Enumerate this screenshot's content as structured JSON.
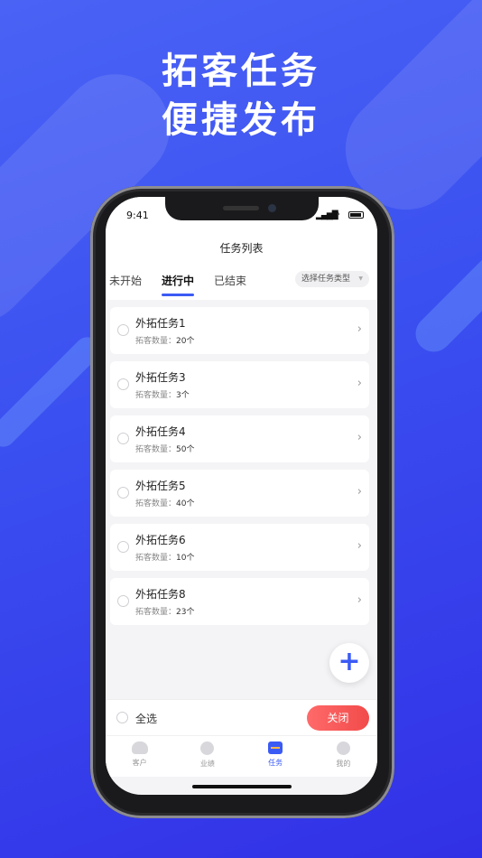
{
  "promo": {
    "line1": "拓客任务",
    "line2": "便捷发布"
  },
  "status_bar": {
    "time": "9:41",
    "signal_icon": "signal-icon",
    "wifi_icon": "wifi-icon",
    "battery_icon": "battery-icon"
  },
  "header": {
    "title": "任务列表"
  },
  "tabs": [
    {
      "label": "未开始",
      "active": false
    },
    {
      "label": "进行中",
      "active": true
    },
    {
      "label": "已结束",
      "active": false
    }
  ],
  "filter": {
    "label": "选择任务类型",
    "icon": "caret-down-icon"
  },
  "tasks": [
    {
      "name": "外拓任务1",
      "count_label": "拓客数量：",
      "count": "20个"
    },
    {
      "name": "外拓任务3",
      "count_label": "拓客数量：",
      "count": "3个"
    },
    {
      "name": "外拓任务4",
      "count_label": "拓客数量：",
      "count": "50个"
    },
    {
      "name": "外拓任务5",
      "count_label": "拓客数量：",
      "count": "40个"
    },
    {
      "name": "外拓任务6",
      "count_label": "拓客数量：",
      "count": "10个"
    },
    {
      "name": "外拓任务8",
      "count_label": "拓客数量：",
      "count": "23个"
    }
  ],
  "fab": {
    "label": "+"
  },
  "bottom_bar": {
    "select_all": "全选",
    "close": "关闭"
  },
  "tabbar": [
    {
      "label": "客户",
      "icon": "customer-icon",
      "active": false
    },
    {
      "label": "业绩",
      "icon": "performance-icon",
      "active": false
    },
    {
      "label": "任务",
      "icon": "task-icon",
      "active": true
    },
    {
      "label": "我的",
      "icon": "profile-icon",
      "active": false
    }
  ],
  "colors": {
    "accent": "#3b5bf5",
    "close_button": "#f24b4b",
    "background_top": "#4a63f5",
    "background_bottom": "#3230e6"
  }
}
